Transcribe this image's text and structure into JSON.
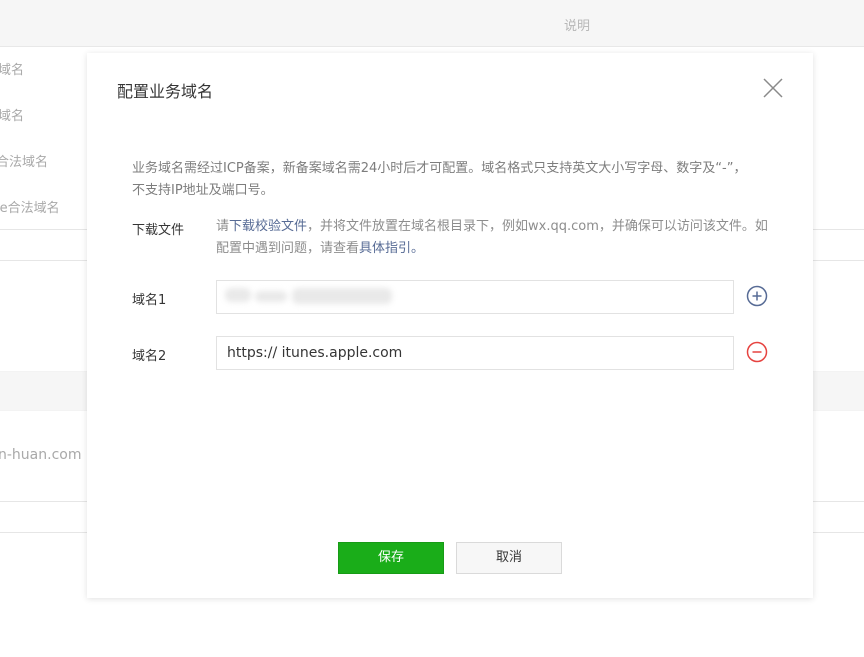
{
  "background": {
    "header_col_desc": "说明",
    "labels": [
      "域名",
      "域名",
      "合法域名",
      "le合法域名"
    ],
    "domain_fragment": "n-huan.com"
  },
  "modal": {
    "title": "配置业务域名",
    "notice": "业务域名需经过ICP备案，新备案域名需24小时后才可配置。域名格式只支持英文大小写字母、数字及“-”，不支持IP地址及端口号。",
    "download_label": "下载文件",
    "download_text_prefix": "请",
    "download_link": "下载校验文件",
    "download_text_mid": "，并将文件放置在域名根目录下，例如wx.qq.com，并确保可以访问该文件。如配置中遇到问题，请查看",
    "guide_link": "具体指引",
    "download_text_suffix": "。",
    "fields": [
      {
        "label": "域名1",
        "value": ""
      },
      {
        "label": "域名2",
        "value": "https:// itunes.apple.com"
      }
    ],
    "save_label": "保存",
    "cancel_label": "取消"
  },
  "colors": {
    "primary": "#1aad19",
    "link": "#576b95",
    "remove": "#e64340",
    "add": "#576b95"
  },
  "icons": {
    "close": "close-icon",
    "add": "plus-circle-icon",
    "remove": "minus-circle-icon"
  }
}
